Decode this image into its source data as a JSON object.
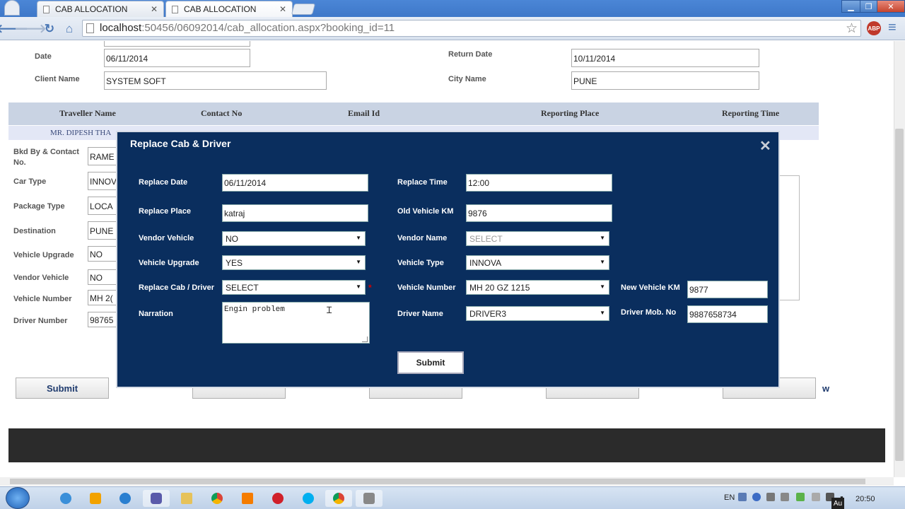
{
  "browser": {
    "tabs": [
      {
        "label": "CAB ALLOCATION"
      },
      {
        "label": "CAB ALLOCATION"
      }
    ],
    "tab_close": "✕",
    "url_host": "localhost",
    "url_rest": ":50456/06092014/cab_allocation.aspx?booking_id=11",
    "abp_label": "ABP"
  },
  "form": {
    "date_label": "Date",
    "date_value": "06/11/2014",
    "return_date_label": "Return Date",
    "return_date_value": "10/11/2014",
    "client_name_label": "Client Name",
    "client_name_value": "SYSTEM SOFT",
    "city_name_label": "City Name",
    "city_name_value": "PUNE"
  },
  "traveller_table": {
    "headers": [
      "Traveller Name",
      "Contact No",
      "Email Id",
      "Reporting Place",
      "Reporting Time"
    ],
    "row_name": "MR. DIPESH THA"
  },
  "left_fields": [
    {
      "label": "Bkd By & Contact No.",
      "value": "RAME"
    },
    {
      "label": "Car Type",
      "value": "INNOV"
    },
    {
      "label": "Package Type",
      "value": "LOCA"
    },
    {
      "label": "Destination",
      "value": "PUNE"
    },
    {
      "label": "Vehicle Upgrade",
      "value": "NO"
    },
    {
      "label": "Vendor Vehicle",
      "value": "NO"
    },
    {
      "label": "Vehicle Number",
      "value": "MH 2("
    },
    {
      "label": "Driver Number",
      "value": "98765"
    }
  ],
  "page_buttons": {
    "submit": "Submit",
    "view_fragment": "w",
    "dot_fragment": "."
  },
  "modal": {
    "title": "Replace Cab & Driver",
    "close": "✕",
    "replace_date_label": "Replace Date",
    "replace_date_value": "06/11/2014",
    "replace_time_label": "Replace Time",
    "replace_time_value": "12:00",
    "replace_place_label": "Replace Place",
    "replace_place_value": "katraj",
    "old_vehicle_km_label": "Old Vehicle KM",
    "old_vehicle_km_value": "9876",
    "vendor_vehicle_label": "Vendor Vehicle",
    "vendor_vehicle_value": "NO",
    "vendor_name_label": "Vendor Name",
    "vendor_name_value": "SELECT",
    "vehicle_upgrade_label": "Vehicle Upgrade",
    "vehicle_upgrade_value": "YES",
    "vehicle_type_label": "Vehicle Type",
    "vehicle_type_value": "INNOVA",
    "replace_cab_driver_label": "Replace Cab / Driver",
    "replace_cab_driver_value": "SELECT",
    "required_mark": "*",
    "vehicle_number_label": "Vehicle Number",
    "vehicle_number_value": "MH 20 GZ 1215",
    "new_vehicle_km_label": "New Vehicle KM",
    "new_vehicle_km_value": "9877",
    "narration_label": "Narration",
    "narration_value": "Engin problem",
    "driver_name_label": "Driver Name",
    "driver_name_value": "DRIVER3",
    "driver_mob_label": "Driver Mob. No",
    "driver_mob_value": "9887658734",
    "submit_label": "Submit"
  },
  "taskbar": {
    "lang": "EN",
    "clock": "20:50",
    "show_desktop": "Au"
  },
  "colors": {
    "modal_bg": "#0a2e5e",
    "table_header_bg": "#c9d3e3",
    "required": "#d40000",
    "footer_bar": "#2b2b2b"
  }
}
